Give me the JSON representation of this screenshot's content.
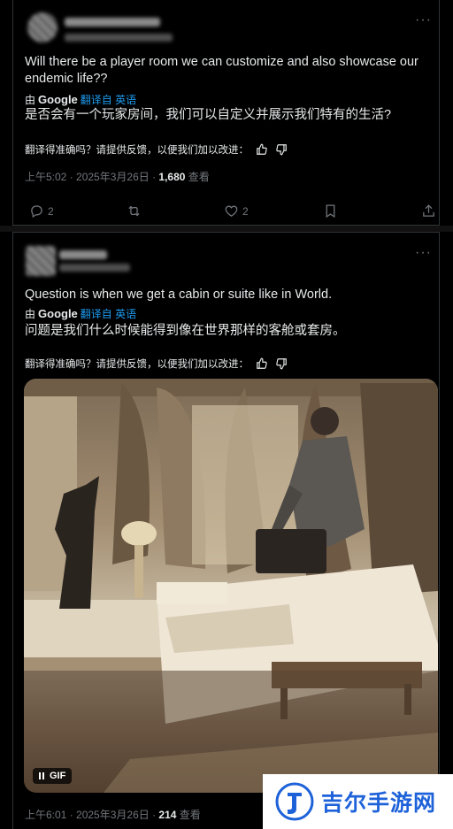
{
  "post1": {
    "more_icon": "more-icon",
    "english_text": "Will there be a player room we can customize and also showcase our endemic life??",
    "translation": {
      "prefix": "由",
      "engine": "Google",
      "link": "翻译自 英语"
    },
    "translated_text": "是否会有一个玩家房间，我们可以自定义并展示我们特有的生活?",
    "feedback_text": "翻译得准确吗？请提供反馈，以便我们加以改进：",
    "meta": {
      "time": "上午5:02 · 2025年3月26日 · ",
      "views": "1,680",
      "views_label": " 查看"
    },
    "actions": {
      "replies": "2",
      "likes": "2"
    }
  },
  "post2": {
    "english_text": "Question is when we get a cabin or suite like in World.",
    "translation": {
      "prefix": "由",
      "engine": "Google",
      "link": "翻译自 英语"
    },
    "translated_text": "问题是我们什么时候能得到像在世界那样的客舱或套房。",
    "feedback_text": "翻译得准确吗？请提供反馈，以便我们加以改进：",
    "gif_label": "GIF",
    "meta": {
      "time": "上午6:01 · 2025年3月26日 · ",
      "views": "214",
      "views_label": " 查看"
    }
  },
  "watermark": {
    "text": "吉尔手游网",
    "color": "#1e62d9"
  },
  "colors": {
    "background": "#000000",
    "text": "#e7e9ea",
    "muted": "#71767b",
    "link": "#1d9bf0"
  }
}
